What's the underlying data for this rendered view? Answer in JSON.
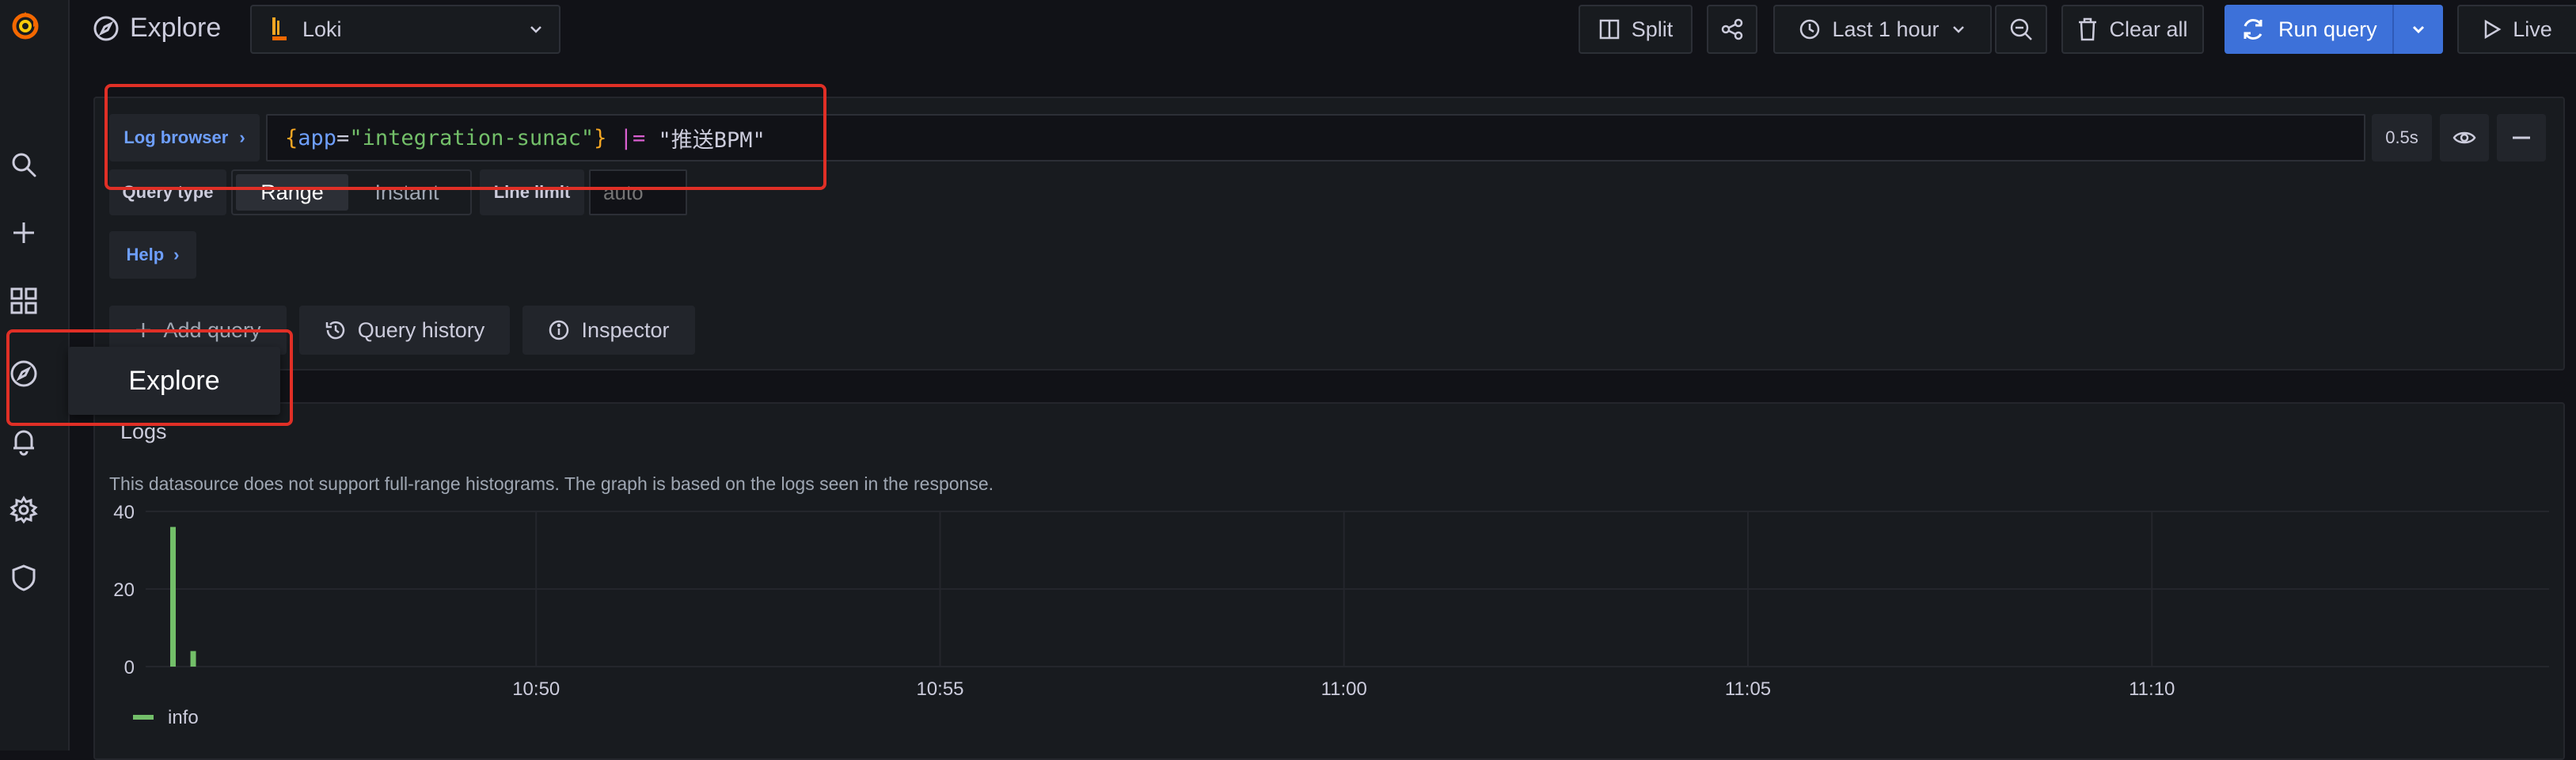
{
  "topbar": {
    "page_title": "Explore",
    "datasource": "Loki",
    "split_label": "Split",
    "time_range_label": "Last 1 hour",
    "clear_label": "Clear all",
    "run_label": "Run query",
    "live_label": "Live"
  },
  "query": {
    "log_browser_label": "Log browser",
    "query_tokens": {
      "brace_open": "{",
      "key": "app",
      "eq": "=",
      "value": "\"integration-sunac\"",
      "brace_close": "}",
      "op": "|=",
      "filter": "\"推送BPM\""
    },
    "duration": "0.5s",
    "query_type_label": "Query type",
    "query_type_options": [
      "Range",
      "Instant"
    ],
    "query_type_selected": "Range",
    "line_limit_label": "Line limit",
    "line_limit_placeholder": "auto",
    "help_label": "Help"
  },
  "actions": {
    "add_query_label": "Add query",
    "history_label": "Query history",
    "inspector_label": "Inspector"
  },
  "tooltip": {
    "label": "Explore"
  },
  "logs": {
    "title": "Logs",
    "notice": "This datasource does not support full-range histograms. The graph is based on the logs seen in the response."
  },
  "colors": {
    "accent_blue": "#3d71d9",
    "series_info": "#73bf69",
    "highlight_red": "#e02f26"
  },
  "chart_data": {
    "type": "bar",
    "title": "",
    "ylim": [
      0,
      40
    ],
    "yticks": [
      0,
      20,
      40
    ],
    "xticks": [
      "10:50",
      "10:55",
      "11:00",
      "11:05",
      "11:10"
    ],
    "grid": true,
    "legend": "bottom-left",
    "series": [
      {
        "name": "info",
        "points": [
          {
            "x": "10:45:30",
            "y": 36
          },
          {
            "x": "10:45:45",
            "y": 4
          }
        ]
      }
    ]
  }
}
